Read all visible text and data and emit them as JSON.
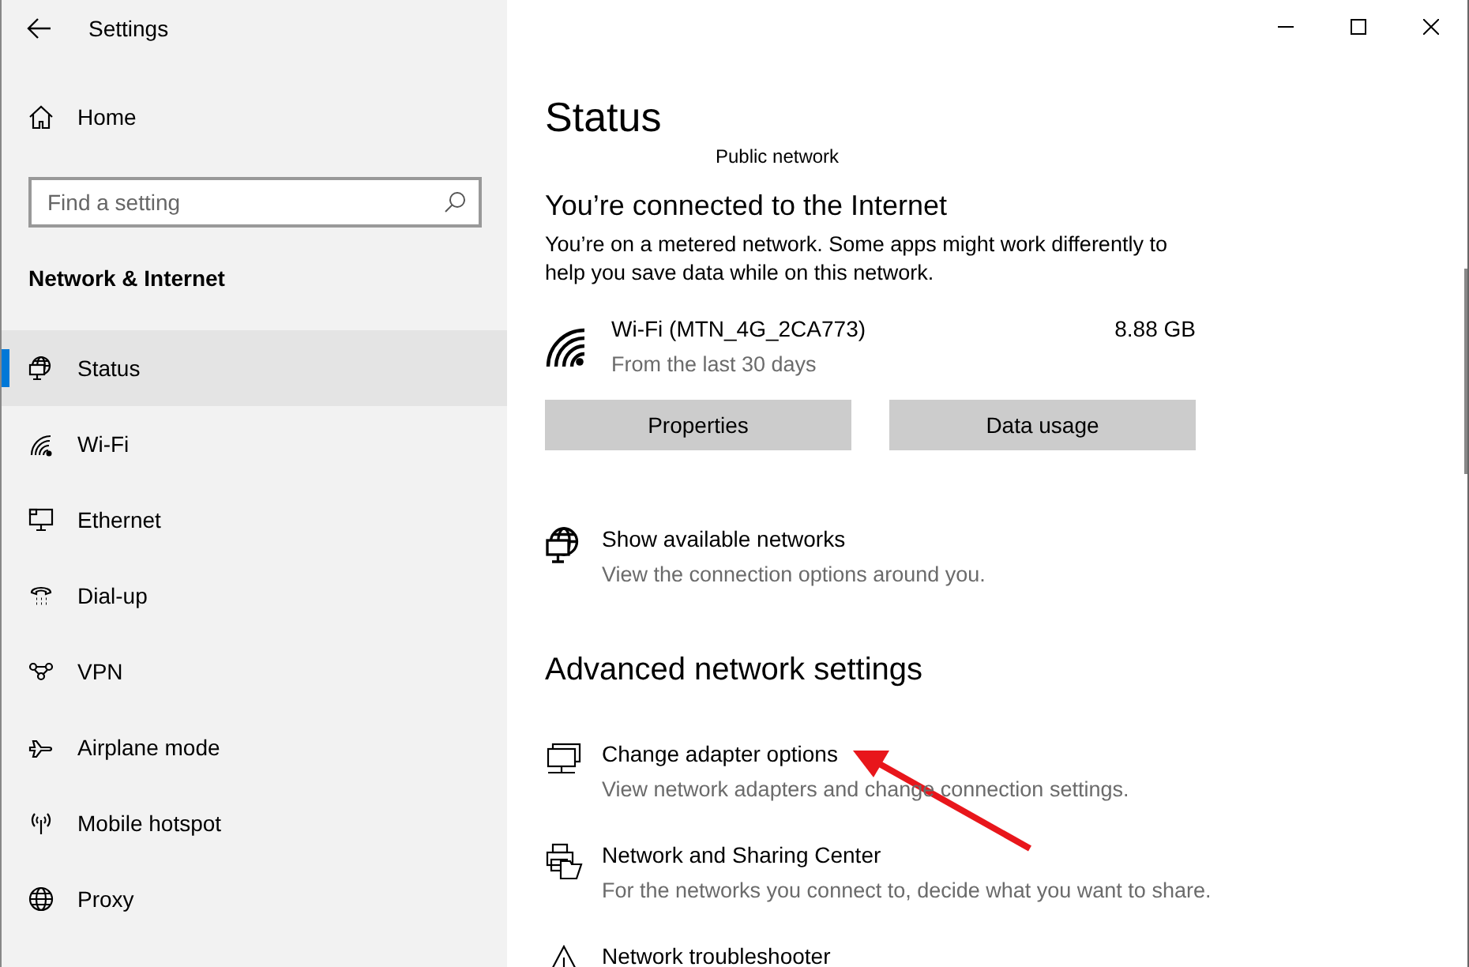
{
  "window": {
    "title": "Settings"
  },
  "sidebar": {
    "home": "Home",
    "search": {
      "placeholder": "Find a setting"
    },
    "section": "Network & Internet",
    "items": [
      {
        "label": "Status",
        "selected": true
      },
      {
        "label": "Wi-Fi",
        "selected": false
      },
      {
        "label": "Ethernet",
        "selected": false
      },
      {
        "label": "Dial-up",
        "selected": false
      },
      {
        "label": "VPN",
        "selected": false
      },
      {
        "label": "Airplane mode",
        "selected": false
      },
      {
        "label": "Mobile hotspot",
        "selected": false
      },
      {
        "label": "Proxy",
        "selected": false
      }
    ]
  },
  "main": {
    "title": "Status",
    "network_type": "Public network",
    "connected_heading": "You’re connected to the Internet",
    "connected_text": "You’re on a metered network. Some apps might work differently to help you save data while on this network.",
    "connection": {
      "name": "Wi-Fi (MTN_4G_2CA773)",
      "period": "From the last 30 days",
      "usage": "8.88 GB"
    },
    "buttons": [
      "Properties",
      "Data usage"
    ],
    "show_networks": {
      "title": "Show available networks",
      "subtitle": "View the connection options around you."
    },
    "advanced_heading": "Advanced network settings",
    "advanced_items": [
      {
        "title": "Change adapter options",
        "subtitle": "View network adapters and change connection settings."
      },
      {
        "title": "Network and Sharing Center",
        "subtitle": "For the networks you connect to, decide what you want to share."
      },
      {
        "title": "Network troubleshooter"
      }
    ]
  }
}
